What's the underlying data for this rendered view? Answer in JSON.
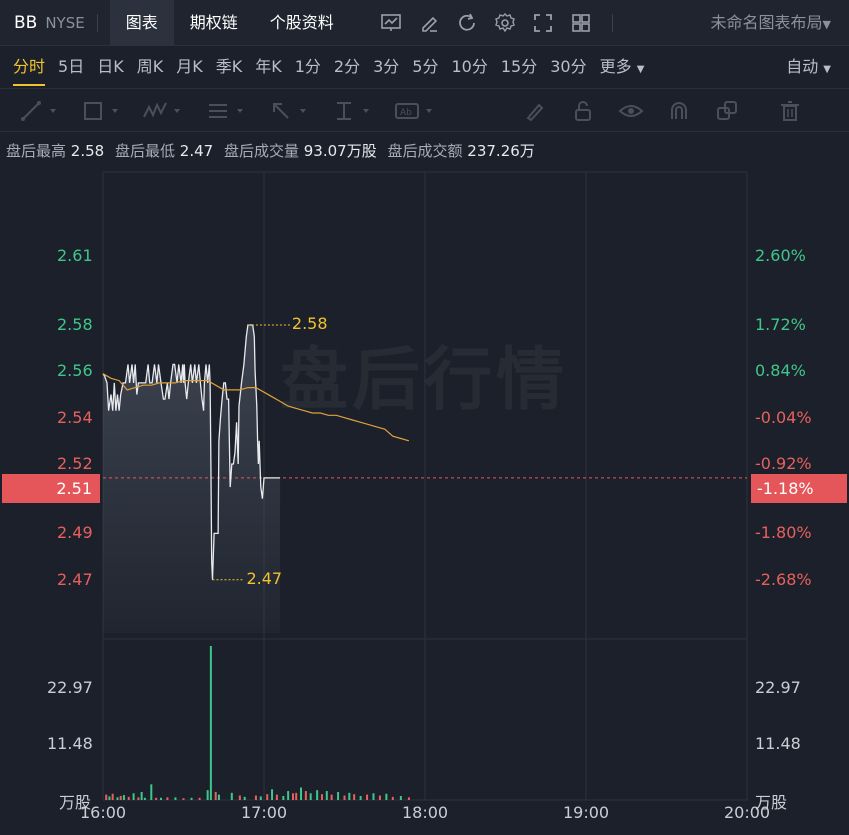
{
  "header": {
    "symbol": "BB",
    "exchange": "NYSE",
    "tabs": [
      "图表",
      "期权链",
      "个股资料"
    ],
    "active_tab": "图表",
    "layout_name": "未命名图表布局",
    "tool_icons": [
      "chart-settings-icon",
      "edit-icon",
      "refresh-icon",
      "gear-icon",
      "fullscreen-icon",
      "grid-layout-icon"
    ]
  },
  "periods": {
    "items": [
      "分时",
      "5日",
      "日K",
      "周K",
      "月K",
      "季K",
      "年K",
      "1分",
      "2分",
      "3分",
      "5分",
      "10分",
      "15分",
      "30分",
      "更多"
    ],
    "active": "分时",
    "mode": "自动"
  },
  "drawing_tools": [
    "line-tool-icon",
    "rect-tool-icon",
    "pattern-tool-icon",
    "fib-tool-icon",
    "arrow-tool-icon",
    "measure-tool-icon",
    "text-tool-icon",
    "brush-icon",
    "lock-icon",
    "eye-icon",
    "magnet-icon",
    "layers-icon",
    "trash-icon"
  ],
  "after_hours": {
    "high_label": "盘后最高",
    "high": "2.58",
    "low_label": "盘后最低",
    "low": "2.47",
    "volume_label": "盘后成交量",
    "volume": "93.07万股",
    "amount_label": "盘后成交额",
    "amount": "237.26万"
  },
  "watermark": "盘后行情",
  "colors": {
    "up": "#3fc78a",
    "down": "#e8605e",
    "avg_line": "#e0a13b",
    "price_line": "#e8eaee",
    "accent": "#f2c230"
  },
  "chart_data": {
    "type": "line",
    "x_ticks": [
      "16:00",
      "17:00",
      "18:00",
      "19:00",
      "20:00"
    ],
    "price_ticks": [
      {
        "price": 2.61,
        "pct": "2.60%"
      },
      {
        "price": 2.58,
        "pct": "1.72%"
      },
      {
        "price": 2.56,
        "pct": "0.84%"
      },
      {
        "price": 2.54,
        "pct": "-0.04%"
      },
      {
        "price": 2.52,
        "pct": "-0.92%"
      },
      {
        "price": 2.49,
        "pct": "-1.80%"
      },
      {
        "price": 2.47,
        "pct": "-2.68%"
      }
    ],
    "current": {
      "price": "2.51",
      "pct": "-1.18%",
      "value": 2.514
    },
    "prev_close": 2.541,
    "ylim": [
      2.447,
      2.634
    ],
    "price_series": [
      [
        0,
        2.559
      ],
      [
        0.01,
        2.558
      ],
      [
        0.025,
        2.555
      ],
      [
        0.035,
        2.543
      ],
      [
        0.05,
        2.55
      ],
      [
        0.06,
        2.543
      ],
      [
        0.07,
        2.555
      ],
      [
        0.08,
        2.543
      ],
      [
        0.09,
        2.55
      ],
      [
        0.1,
        2.543
      ],
      [
        0.11,
        2.55
      ],
      [
        0.125,
        2.555
      ],
      [
        0.14,
        2.555
      ],
      [
        0.155,
        2.563
      ],
      [
        0.165,
        2.555
      ],
      [
        0.18,
        2.563
      ],
      [
        0.19,
        2.555
      ],
      [
        0.2,
        2.563
      ],
      [
        0.21,
        2.55
      ],
      [
        0.22,
        2.555
      ],
      [
        0.235,
        2.555
      ],
      [
        0.25,
        2.555
      ],
      [
        0.265,
        2.555
      ],
      [
        0.28,
        2.563
      ],
      [
        0.29,
        2.555
      ],
      [
        0.305,
        2.555
      ],
      [
        0.32,
        2.563
      ],
      [
        0.335,
        2.555
      ],
      [
        0.345,
        2.563
      ],
      [
        0.36,
        2.555
      ],
      [
        0.375,
        2.548
      ],
      [
        0.385,
        2.548
      ],
      [
        0.4,
        2.555
      ],
      [
        0.41,
        2.548
      ],
      [
        0.42,
        2.555
      ],
      [
        0.435,
        2.563
      ],
      [
        0.445,
        2.563
      ],
      [
        0.46,
        2.555
      ],
      [
        0.47,
        2.563
      ],
      [
        0.485,
        2.555
      ],
      [
        0.495,
        2.563
      ],
      [
        0.5,
        2.555
      ],
      [
        0.505,
        2.563
      ],
      [
        0.51,
        2.555
      ],
      [
        0.52,
        2.548
      ],
      [
        0.53,
        2.555
      ],
      [
        0.545,
        2.563
      ],
      [
        0.555,
        2.555
      ],
      [
        0.57,
        2.563
      ],
      [
        0.58,
        2.555
      ],
      [
        0.595,
        2.563
      ],
      [
        0.605,
        2.555
      ],
      [
        0.615,
        2.548
      ],
      [
        0.625,
        2.543
      ],
      [
        0.63,
        2.555
      ],
      [
        0.64,
        2.563
      ],
      [
        0.65,
        2.555
      ],
      [
        0.66,
        2.563
      ],
      [
        0.665,
        2.555
      ],
      [
        0.67,
        2.52
      ],
      [
        0.675,
        2.478
      ],
      [
        0.68,
        2.47
      ],
      [
        0.69,
        2.49
      ],
      [
        0.7,
        2.49
      ],
      [
        0.715,
        2.49
      ],
      [
        0.72,
        2.53
      ],
      [
        0.73,
        2.54
      ],
      [
        0.74,
        2.548
      ],
      [
        0.75,
        2.555
      ],
      [
        0.76,
        2.555
      ],
      [
        0.77,
        2.548
      ],
      [
        0.78,
        2.548
      ],
      [
        0.79,
        2.51
      ],
      [
        0.8,
        2.52
      ],
      [
        0.81,
        2.52
      ],
      [
        0.82,
        2.525
      ],
      [
        0.83,
        2.538
      ],
      [
        0.84,
        2.52
      ],
      [
        0.845,
        2.545
      ],
      [
        0.86,
        2.555
      ],
      [
        0.875,
        2.563
      ],
      [
        0.89,
        2.575
      ],
      [
        0.9,
        2.58
      ],
      [
        0.915,
        2.58
      ],
      [
        0.93,
        2.58
      ],
      [
        0.94,
        2.575
      ],
      [
        0.945,
        2.56
      ],
      [
        0.955,
        2.545
      ],
      [
        0.96,
        2.53
      ],
      [
        0.965,
        2.52
      ],
      [
        0.97,
        2.53
      ],
      [
        0.975,
        2.52
      ],
      [
        0.98,
        2.51
      ],
      [
        0.99,
        2.505
      ],
      [
        1.0,
        2.514
      ],
      [
        1.015,
        2.514
      ],
      [
        1.03,
        2.514
      ],
      [
        1.045,
        2.514
      ],
      [
        1.06,
        2.514
      ],
      [
        1.075,
        2.514
      ],
      [
        1.09,
        2.514
      ],
      [
        1.1,
        2.514
      ]
    ],
    "avg_series": [
      [
        0,
        2.559
      ],
      [
        0.05,
        2.557
      ],
      [
        0.1,
        2.556
      ],
      [
        0.15,
        2.552
      ],
      [
        0.2,
        2.553
      ],
      [
        0.25,
        2.554
      ],
      [
        0.3,
        2.554
      ],
      [
        0.35,
        2.555
      ],
      [
        0.4,
        2.555
      ],
      [
        0.45,
        2.555
      ],
      [
        0.5,
        2.556
      ],
      [
        0.55,
        2.556
      ],
      [
        0.6,
        2.556
      ],
      [
        0.65,
        2.556
      ],
      [
        0.7,
        2.554
      ],
      [
        0.75,
        2.552
      ],
      [
        0.8,
        2.552
      ],
      [
        0.85,
        2.552
      ],
      [
        0.9,
        2.553
      ],
      [
        0.95,
        2.553
      ],
      [
        1.0,
        2.551
      ],
      [
        1.05,
        2.549
      ],
      [
        1.1,
        2.547
      ],
      [
        1.15,
        2.545
      ],
      [
        1.2,
        2.544
      ],
      [
        1.25,
        2.543
      ],
      [
        1.3,
        2.542
      ],
      [
        1.35,
        2.542
      ],
      [
        1.4,
        2.541
      ],
      [
        1.45,
        2.541
      ],
      [
        1.5,
        2.54
      ],
      [
        1.55,
        2.539
      ],
      [
        1.6,
        2.538
      ],
      [
        1.65,
        2.537
      ],
      [
        1.7,
        2.536
      ],
      [
        1.75,
        2.535
      ],
      [
        1.8,
        2.532
      ],
      [
        1.85,
        2.531
      ],
      [
        1.9,
        2.53
      ]
    ],
    "high_annotation": {
      "t": 0.9,
      "price": 2.58,
      "label": "2.58"
    },
    "low_annotation": {
      "t": 0.68,
      "price": 2.47,
      "label": "2.47"
    },
    "volume": {
      "unit": "万股",
      "ticks": [
        "22.97",
        "11.48"
      ],
      "ylim": [
        0,
        34.4
      ],
      "bars": [
        {
          "t": 0.02,
          "v": 1.2,
          "up": 0
        },
        {
          "t": 0.04,
          "v": 0.8,
          "up": 1
        },
        {
          "t": 0.06,
          "v": 1.4,
          "up": 0
        },
        {
          "t": 0.09,
          "v": 0.6,
          "up": 1
        },
        {
          "t": 0.11,
          "v": 0.9,
          "up": 0
        },
        {
          "t": 0.13,
          "v": 1.1,
          "up": 1
        },
        {
          "t": 0.16,
          "v": 0.7,
          "up": 0
        },
        {
          "t": 0.19,
          "v": 1.5,
          "up": 1
        },
        {
          "t": 0.22,
          "v": 0.6,
          "up": 0
        },
        {
          "t": 0.24,
          "v": 1.8,
          "up": 1
        },
        {
          "t": 0.26,
          "v": 0.5,
          "up": 1
        },
        {
          "t": 0.3,
          "v": 3.5,
          "up": 1
        },
        {
          "t": 0.33,
          "v": 0.5,
          "up": 0
        },
        {
          "t": 0.36,
          "v": 0.5,
          "up": 1
        },
        {
          "t": 0.4,
          "v": 0.6,
          "up": 0
        },
        {
          "t": 0.45,
          "v": 0.6,
          "up": 1
        },
        {
          "t": 0.5,
          "v": 0.4,
          "up": 0
        },
        {
          "t": 0.55,
          "v": 0.5,
          "up": 1
        },
        {
          "t": 0.6,
          "v": 0.5,
          "up": 0
        },
        {
          "t": 0.65,
          "v": 2.2,
          "up": 1
        },
        {
          "t": 0.67,
          "v": 34.4,
          "up": 1
        },
        {
          "t": 0.7,
          "v": 1.8,
          "up": 0
        },
        {
          "t": 0.72,
          "v": 1.2,
          "up": 1
        },
        {
          "t": 0.8,
          "v": 1.6,
          "up": 1
        },
        {
          "t": 0.85,
          "v": 1.0,
          "up": 0
        },
        {
          "t": 0.88,
          "v": 0.7,
          "up": 1
        },
        {
          "t": 0.95,
          "v": 1.0,
          "up": 0
        },
        {
          "t": 0.98,
          "v": 0.8,
          "up": 1
        },
        {
          "t": 1.02,
          "v": 1.3,
          "up": 0
        },
        {
          "t": 1.05,
          "v": 2.4,
          "up": 1
        },
        {
          "t": 1.08,
          "v": 1.2,
          "up": 0
        },
        {
          "t": 1.12,
          "v": 0.9,
          "up": 1
        },
        {
          "t": 1.15,
          "v": 2.0,
          "up": 1
        },
        {
          "t": 1.18,
          "v": 1.5,
          "up": 0
        },
        {
          "t": 1.2,
          "v": 1.6,
          "up": 0
        },
        {
          "t": 1.23,
          "v": 2.8,
          "up": 1
        },
        {
          "t": 1.26,
          "v": 2.0,
          "up": 0
        },
        {
          "t": 1.29,
          "v": 1.5,
          "up": 1
        },
        {
          "t": 1.33,
          "v": 2.2,
          "up": 1
        },
        {
          "t": 1.36,
          "v": 1.3,
          "up": 0
        },
        {
          "t": 1.39,
          "v": 2.0,
          "up": 1
        },
        {
          "t": 1.42,
          "v": 1.2,
          "up": 0
        },
        {
          "t": 1.46,
          "v": 1.8,
          "up": 1
        },
        {
          "t": 1.5,
          "v": 1.0,
          "up": 0
        },
        {
          "t": 1.53,
          "v": 1.6,
          "up": 1
        },
        {
          "t": 1.56,
          "v": 1.3,
          "up": 0
        },
        {
          "t": 1.6,
          "v": 0.9,
          "up": 1
        },
        {
          "t": 1.64,
          "v": 1.2,
          "up": 0
        },
        {
          "t": 1.68,
          "v": 1.5,
          "up": 1
        },
        {
          "t": 1.72,
          "v": 1.0,
          "up": 0
        },
        {
          "t": 1.76,
          "v": 1.4,
          "up": 1
        },
        {
          "t": 1.8,
          "v": 0.7,
          "up": 0
        },
        {
          "t": 1.85,
          "v": 0.9,
          "up": 1
        },
        {
          "t": 1.9,
          "v": 0.6,
          "up": 0
        }
      ]
    }
  }
}
